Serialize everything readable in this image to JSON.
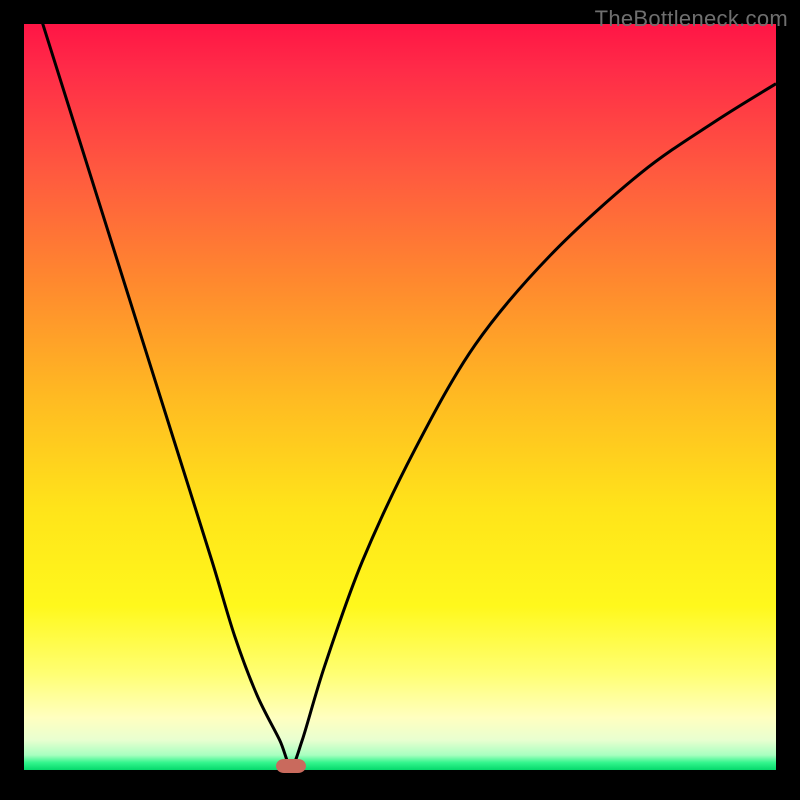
{
  "watermark": "TheBottleneck.com",
  "colors": {
    "curve": "#000000",
    "marker": "#c96a5d",
    "frame": "#000000"
  },
  "chart_data": {
    "type": "line",
    "title": "",
    "xlabel": "",
    "ylabel": "",
    "xlim": [
      0,
      100
    ],
    "ylim": [
      0,
      100
    ],
    "grid": false,
    "legend": false,
    "background": "red-yellow-green vertical gradient (high=red, low=green)",
    "series": [
      {
        "name": "bottleneck-curve",
        "x": [
          0,
          5,
          10,
          15,
          20,
          25,
          28,
          31,
          34,
          35.5,
          37,
          40,
          45,
          52,
          60,
          70,
          82,
          92,
          100
        ],
        "y": [
          108,
          92,
          76,
          60,
          44,
          28,
          18,
          10,
          4,
          0.5,
          4,
          14,
          28,
          43,
          57,
          69,
          80,
          87,
          92
        ]
      }
    ],
    "annotations": [
      {
        "name": "minimum-marker",
        "type": "ellipse",
        "x": 35.5,
        "y": 0.5,
        "color": "#c96a5d"
      }
    ]
  }
}
